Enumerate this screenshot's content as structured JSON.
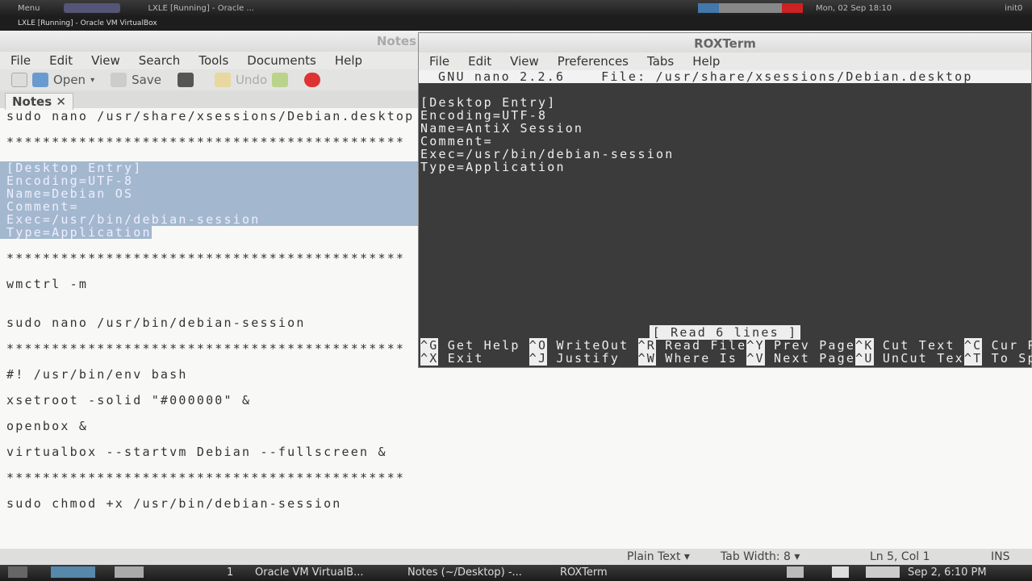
{
  "top_panel": {
    "menu": "Menu",
    "task": "LXLE [Running] - Oracle ...",
    "clock": "Mon, 02 Sep  18:10",
    "user": "init0"
  },
  "vbox_title": "LXLE [Running] - Oracle VM VirtualBox",
  "notes": {
    "title": "Notes",
    "menu": [
      "File",
      "Edit",
      "View",
      "Search",
      "Tools",
      "Documents",
      "Help"
    ],
    "toolbar": {
      "open": "Open",
      "save": "Save",
      "undo": "Undo"
    },
    "tab": "Notes",
    "lines": [
      "sudo nano /usr/share/xsessions/Debian.desktop",
      "",
      "********************************************",
      "",
      "[Desktop Entry]",
      "Encoding=UTF-8",
      "Name=Debian OS",
      "Comment=",
      "Exec=/usr/bin/debian-session",
      "Type=Application",
      "",
      "********************************************",
      "",
      "wmctrl -m",
      "",
      "",
      "sudo nano /usr/bin/debian-session",
      "",
      "********************************************",
      "",
      "#! /usr/bin/env bash",
      "",
      "xsetroot -solid \"#000000\" &",
      "",
      "openbox &",
      "",
      "virtualbox --startvm Debian --fullscreen &",
      "",
      "********************************************",
      "",
      "sudo chmod +x /usr/bin/debian-session"
    ]
  },
  "terminal": {
    "title": "ROXTerm",
    "menu": [
      "File",
      "Edit",
      "View",
      "Preferences",
      "Tabs",
      "Help"
    ],
    "nano_header": "GNU nano 2.2.6    File: /usr/share/xsessions/Debian.desktop",
    "lines": [
      "[Desktop Entry]",
      "Encoding=UTF-8",
      "Name=AntiX Session",
      "Comment=",
      "Exec=/usr/bin/debian-session",
      "Type=Application"
    ],
    "status": "[ Read 6 lines ]",
    "shortcuts_row1": [
      [
        "^G",
        "Get Help "
      ],
      [
        "^O",
        "WriteOut "
      ],
      [
        "^R",
        "Read File"
      ],
      [
        "^Y",
        "Prev Page"
      ],
      [
        "^K",
        "Cut Text "
      ],
      [
        "^C",
        "Cur Pos"
      ]
    ],
    "shortcuts_row2": [
      [
        "^X",
        "Exit     "
      ],
      [
        "^J",
        "Justify  "
      ],
      [
        "^W",
        "Where Is "
      ],
      [
        "^V",
        "Next Page"
      ],
      [
        "^U",
        "UnCut Tex"
      ],
      [
        "^T",
        "To Spell"
      ]
    ]
  },
  "statusbar": {
    "syntax": "Plain Text ▾",
    "tab_width": "Tab Width: 8 ▾",
    "position": "Ln 5, Col 1",
    "mode": "INS"
  },
  "taskbar": {
    "desk": "1",
    "items": [
      "Oracle VM VirtualB...",
      "Notes (~/Desktop) -...",
      "ROXTerm"
    ],
    "clock": "Sep  2, 6:10 PM"
  }
}
